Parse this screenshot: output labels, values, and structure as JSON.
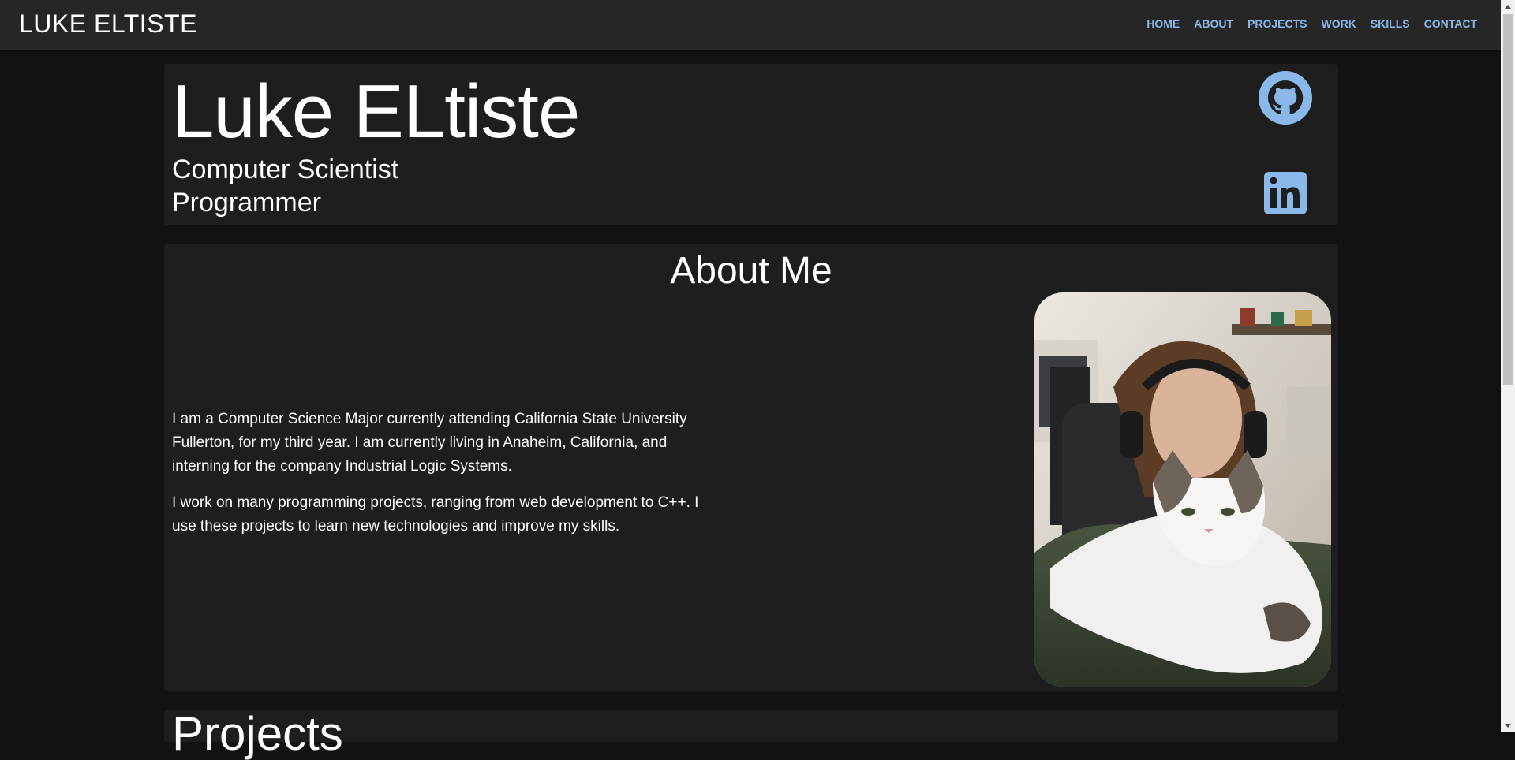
{
  "navbar": {
    "brand": "LUKE ELTISTE",
    "links": [
      "HOME",
      "ABOUT",
      "PROJECTS",
      "WORK",
      "SKILLS",
      "CONTACT"
    ]
  },
  "hero": {
    "name": "Luke ELtiste",
    "subtitle_line1": "Computer Scientist",
    "subtitle_line2": "Programmer"
  },
  "about": {
    "title": "About Me",
    "paragraph1": "I am a Computer Science Major currently attending California State University Fullerton, for my third year. I am currently living in Anaheim, California, and interning for the company Industrial Logic Systems.",
    "paragraph2": "I work on many programming projects, ranging from web development to C++. I use these projects to learn new technologies and improve my skills."
  },
  "next_section": {
    "title": "Projects"
  },
  "colors": {
    "accent": "#8ab8e8",
    "page_bg": "#121212",
    "card_bg": "#1e1e1e",
    "navbar_bg": "#262626"
  },
  "icons": [
    "github-icon",
    "linkedin-icon"
  ]
}
